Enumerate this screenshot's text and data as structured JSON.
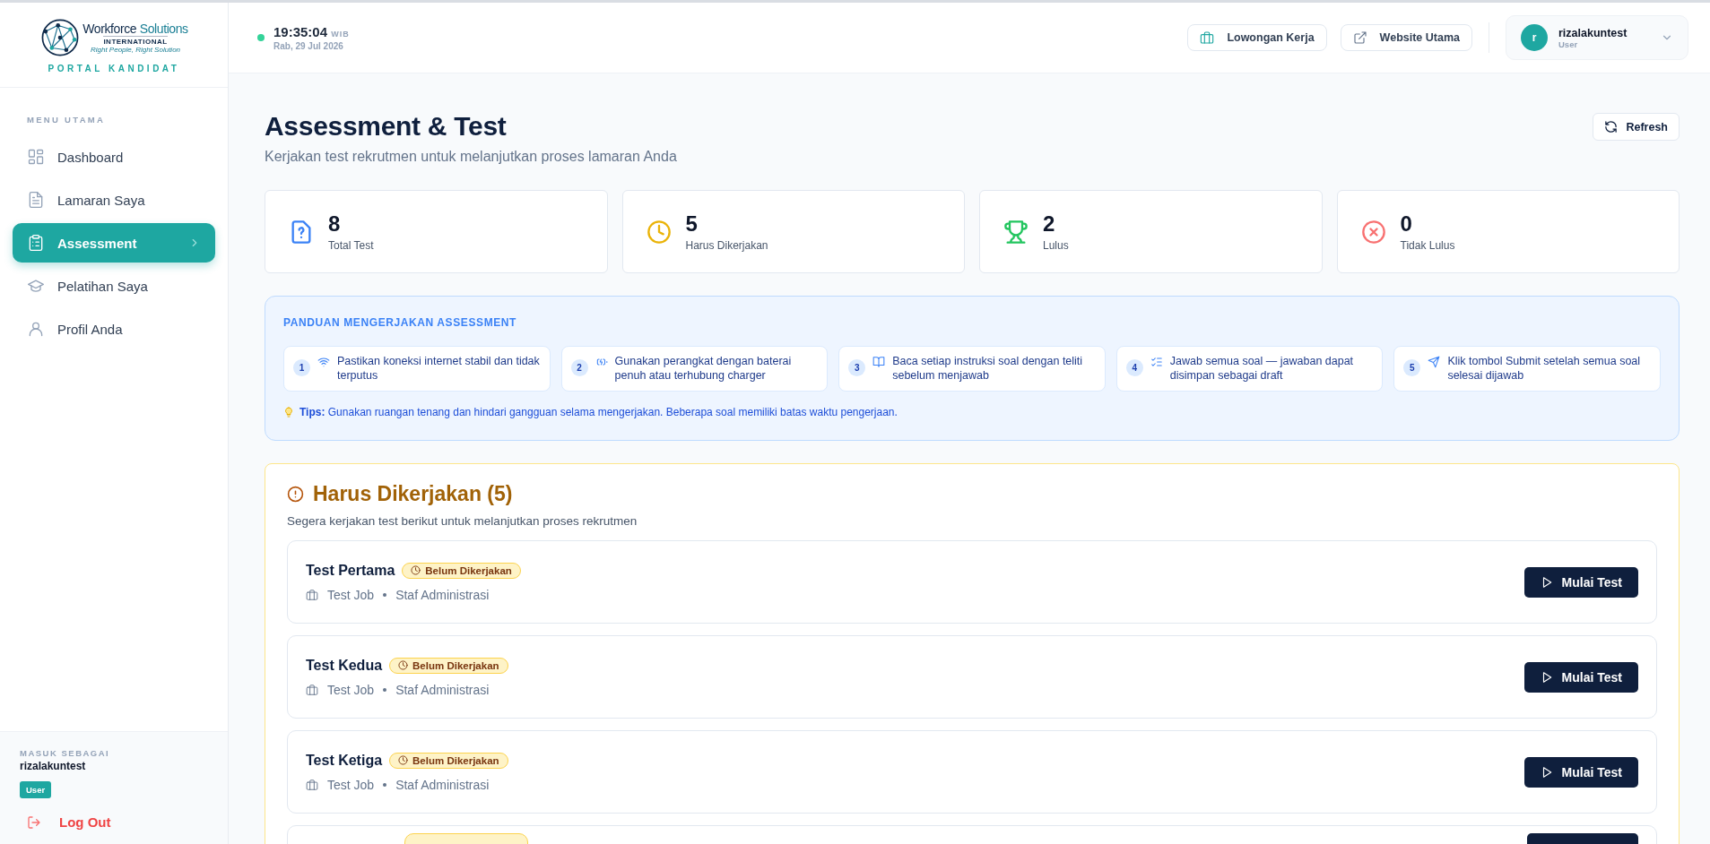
{
  "brand": {
    "name_1": "Workforce",
    "name_2": "Solutions",
    "sub": "INTERNATIONAL",
    "tagline": "Right People, Right Solution",
    "portal": "PORTAL KANDIDAT"
  },
  "sidebar": {
    "section_label": "MENU UTAMA",
    "items": [
      {
        "label": "Dashboard",
        "kind": "grid",
        "selected": false
      },
      {
        "label": "Lamaran Saya",
        "kind": "file",
        "selected": false
      },
      {
        "label": "Assessment",
        "kind": "clipboard",
        "selected": true
      },
      {
        "label": "Pelatihan Saya",
        "kind": "cap",
        "selected": false
      },
      {
        "label": "Profil Anda",
        "kind": "user",
        "selected": false
      }
    ],
    "footer": {
      "label": "MASUK SEBAGAI",
      "username": "rizalakuntest",
      "role": "User",
      "logout": "Log Out"
    }
  },
  "header": {
    "time": "19:35:04",
    "timezone": "WIB",
    "date": "Rab, 29 Jul 2026",
    "links": [
      {
        "label": "Lowongan Kerja",
        "kind": "briefcase"
      },
      {
        "label": "Website Utama",
        "kind": "external"
      }
    ],
    "user": {
      "initial": "r",
      "name": "rizalakuntest",
      "role": "User"
    }
  },
  "page": {
    "title": "Assessment & Test",
    "subtitle": "Kerjakan test rekrutmen untuk melanjutkan proses lamaran Anda",
    "refresh": "Refresh"
  },
  "stats": [
    {
      "value": "8",
      "label": "Total Test",
      "kind": "question",
      "color": "#3b82f6"
    },
    {
      "value": "5",
      "label": "Harus Dikerjakan",
      "kind": "clock",
      "color": "#eab308"
    },
    {
      "value": "2",
      "label": "Lulus",
      "kind": "trophy",
      "color": "#22c55e"
    },
    {
      "value": "0",
      "label": "Tidak Lulus",
      "kind": "x-circle",
      "color": "#f87171"
    }
  ],
  "guide": {
    "title": "PANDUAN MENGERJAKAN ASSESSMENT",
    "steps": [
      {
        "number": "1",
        "kind": "wifi",
        "text": "Pastikan koneksi internet stabil dan tidak terputus"
      },
      {
        "number": "2",
        "kind": "battery",
        "text": "Gunakan perangkat dengan baterai penuh atau terhubung charger"
      },
      {
        "number": "3",
        "kind": "book",
        "text": "Baca setiap instruksi soal dengan teliti sebelum menjawab"
      },
      {
        "number": "4",
        "kind": "list",
        "text": "Jawab semua soal — jawaban dapat disimpan sebagai draft"
      },
      {
        "number": "5",
        "kind": "send",
        "text": "Klik tombol Submit setelah semua soal selesai dijawab"
      }
    ],
    "tips": "**Tips:** Gunakan ruangan tenang dan hindari gangguan selama mengerjakan. Beberapa soal memiliki batas waktu pengerjaan."
  },
  "pending": {
    "title": "Harus Dikerjakan (5)",
    "subtitle": "Segera kerjakan test berikut untuk melanjutkan proses rekrutmen",
    "tests": [
      {
        "name": "Test Pertama",
        "status": "Belum Dikerjakan",
        "job": "Test Job",
        "position": "Staf Administrasi",
        "action": "Mulai Test"
      },
      {
        "name": "Test Kedua",
        "status": "Belum Dikerjakan",
        "job": "Test Job",
        "position": "Staf Administrasi",
        "action": "Mulai Test"
      },
      {
        "name": "Test Ketiga",
        "status": "Belum Dikerjakan",
        "job": "Test Job",
        "position": "Staf Administrasi",
        "action": "Mulai Test"
      }
    ],
    "more_below": true
  }
}
